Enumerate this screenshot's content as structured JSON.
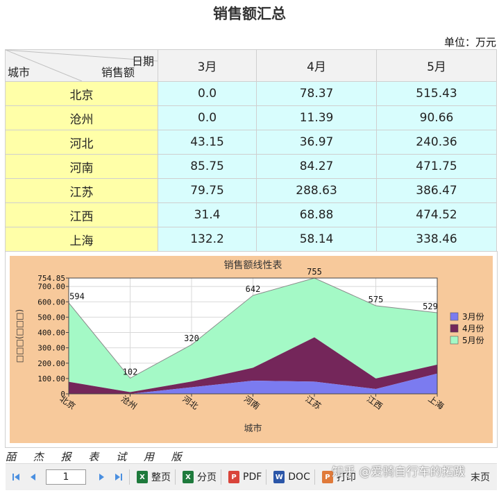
{
  "title": "销售额汇总",
  "unit": "单位：万元",
  "table": {
    "corner": {
      "top": "日期",
      "left": "城市",
      "middle": "销售额"
    },
    "columns": [
      "3月",
      "4月",
      "5月"
    ],
    "rows": [
      {
        "city": "北京",
        "values": [
          "0.0",
          "78.37",
          "515.43"
        ]
      },
      {
        "city": "沧州",
        "values": [
          "0.0",
          "11.39",
          "90.66"
        ]
      },
      {
        "city": "河北",
        "values": [
          "43.15",
          "36.97",
          "240.36"
        ]
      },
      {
        "city": "河南",
        "values": [
          "85.75",
          "84.27",
          "471.75"
        ]
      },
      {
        "city": "江苏",
        "values": [
          "79.75",
          "288.63",
          "386.47"
        ]
      },
      {
        "city": "江西",
        "values": [
          "31.4",
          "68.88",
          "474.52"
        ]
      },
      {
        "city": "上海",
        "values": [
          "132.2",
          "58.14",
          "338.46"
        ]
      }
    ]
  },
  "chart_data": {
    "type": "area",
    "stacked": true,
    "title": "销售额线性表",
    "xlabel": "城市",
    "ylabel": "□□□(□□□)",
    "categories": [
      "北京",
      "沧州",
      "河北",
      "河南",
      "江苏",
      "江西",
      "上海"
    ],
    "ylim": [
      0,
      754.85
    ],
    "yticks": [
      "0",
      "100.00",
      "200.00",
      "300.00",
      "400.00",
      "500.00",
      "600.00",
      "700.00",
      "754.85"
    ],
    "grid": true,
    "legend": "right",
    "series": [
      {
        "name": "3月份",
        "color": "#7b7bf0",
        "values": [
          0.0,
          0.0,
          43.15,
          85.75,
          79.75,
          31.4,
          132.2
        ]
      },
      {
        "name": "4月份",
        "color": "#74265a",
        "values": [
          78.37,
          11.39,
          36.97,
          84.27,
          288.63,
          68.88,
          58.14
        ]
      },
      {
        "name": "5月份",
        "color": "#a4f9c6",
        "values": [
          515.43,
          90.66,
          240.36,
          471.75,
          386.47,
          474.52,
          338.46
        ]
      }
    ],
    "total_labels": [
      "594",
      "102",
      "320",
      "642",
      "755",
      "575",
      "529"
    ],
    "background": "#f7c99b"
  },
  "trial_text": "皕 杰 报 表 试 用 版",
  "toolbar": {
    "page_value": "1",
    "buttons": [
      {
        "label": "整页",
        "icon": "excel-icon"
      },
      {
        "label": "分页",
        "icon": "excel-icon"
      },
      {
        "label": "PDF",
        "icon": "pdf-icon"
      },
      {
        "label": "DOC",
        "icon": "word-icon"
      },
      {
        "label": "打印",
        "icon": "print-icon"
      }
    ],
    "last_label": "末页"
  },
  "watermark": "知乎 @爱骑自行车的拓跋"
}
